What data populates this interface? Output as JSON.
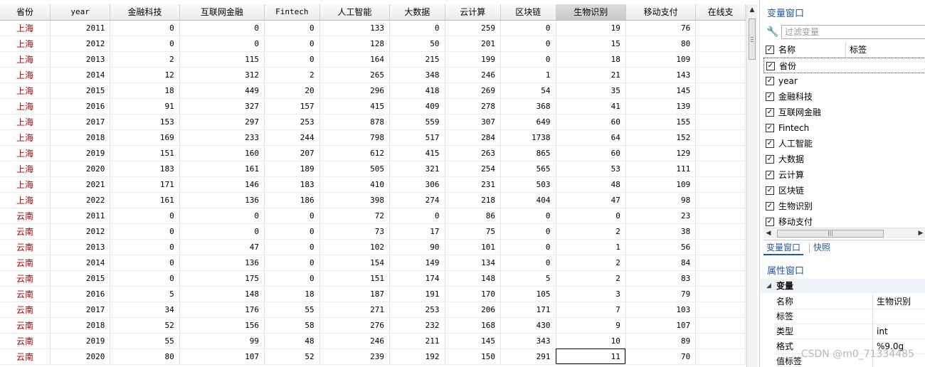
{
  "grid": {
    "columns": [
      {
        "label": "省份",
        "width": 71
      },
      {
        "label": "year",
        "width": 85,
        "mono": true
      },
      {
        "label": "金融科技",
        "width": 98
      },
      {
        "label": "互联网金融",
        "width": 120
      },
      {
        "label": "Fintech",
        "width": 78,
        "mono": true
      },
      {
        "label": "人工智能",
        "width": 99
      },
      {
        "label": "大数据",
        "width": 78
      },
      {
        "label": "云计算",
        "width": 79
      },
      {
        "label": "区块链",
        "width": 78
      },
      {
        "label": "生物识别",
        "width": 99,
        "selected": true
      },
      {
        "label": "移动支付",
        "width": 99
      },
      {
        "label": "在线支",
        "width": 70
      }
    ],
    "rows": [
      [
        "上海",
        "2011",
        "0",
        "0",
        "0",
        "133",
        "0",
        "259",
        "0",
        "19",
        "76",
        ""
      ],
      [
        "上海",
        "2012",
        "0",
        "0",
        "0",
        "128",
        "50",
        "201",
        "0",
        "15",
        "80",
        ""
      ],
      [
        "上海",
        "2013",
        "2",
        "115",
        "0",
        "164",
        "215",
        "199",
        "0",
        "18",
        "109",
        ""
      ],
      [
        "上海",
        "2014",
        "12",
        "312",
        "2",
        "265",
        "348",
        "246",
        "1",
        "21",
        "143",
        ""
      ],
      [
        "上海",
        "2015",
        "18",
        "449",
        "20",
        "296",
        "418",
        "269",
        "54",
        "35",
        "145",
        ""
      ],
      [
        "上海",
        "2016",
        "91",
        "327",
        "157",
        "415",
        "409",
        "278",
        "368",
        "41",
        "139",
        ""
      ],
      [
        "上海",
        "2017",
        "153",
        "297",
        "253",
        "878",
        "559",
        "307",
        "649",
        "60",
        "155",
        ""
      ],
      [
        "上海",
        "2018",
        "169",
        "233",
        "244",
        "798",
        "517",
        "284",
        "1738",
        "64",
        "152",
        ""
      ],
      [
        "上海",
        "2019",
        "151",
        "160",
        "207",
        "612",
        "415",
        "263",
        "865",
        "60",
        "129",
        ""
      ],
      [
        "上海",
        "2020",
        "183",
        "161",
        "189",
        "505",
        "321",
        "254",
        "565",
        "53",
        "111",
        ""
      ],
      [
        "上海",
        "2021",
        "171",
        "146",
        "183",
        "410",
        "306",
        "231",
        "503",
        "48",
        "109",
        ""
      ],
      [
        "上海",
        "2022",
        "161",
        "136",
        "186",
        "398",
        "274",
        "218",
        "404",
        "47",
        "98",
        ""
      ],
      [
        "云南",
        "2011",
        "0",
        "0",
        "0",
        "72",
        "0",
        "86",
        "0",
        "0",
        "23",
        ""
      ],
      [
        "云南",
        "2012",
        "0",
        "0",
        "0",
        "73",
        "17",
        "75",
        "0",
        "2",
        "38",
        ""
      ],
      [
        "云南",
        "2013",
        "0",
        "47",
        "0",
        "102",
        "90",
        "101",
        "0",
        "1",
        "56",
        ""
      ],
      [
        "云南",
        "2014",
        "0",
        "136",
        "0",
        "154",
        "149",
        "134",
        "0",
        "2",
        "84",
        ""
      ],
      [
        "云南",
        "2015",
        "0",
        "175",
        "0",
        "151",
        "174",
        "148",
        "5",
        "2",
        "83",
        ""
      ],
      [
        "云南",
        "2016",
        "5",
        "148",
        "18",
        "187",
        "191",
        "170",
        "105",
        "3",
        "79",
        ""
      ],
      [
        "云南",
        "2017",
        "34",
        "176",
        "55",
        "271",
        "253",
        "206",
        "171",
        "7",
        "103",
        ""
      ],
      [
        "云南",
        "2018",
        "52",
        "156",
        "58",
        "276",
        "232",
        "168",
        "430",
        "9",
        "107",
        ""
      ],
      [
        "云南",
        "2019",
        "55",
        "99",
        "48",
        "246",
        "211",
        "145",
        "343",
        "10",
        "89",
        ""
      ],
      [
        "云南",
        "2020",
        "80",
        "107",
        "52",
        "239",
        "192",
        "150",
        "291",
        "11",
        "70",
        ""
      ]
    ],
    "focused_row": 21,
    "focused_col": 9
  },
  "variables_window": {
    "title": "变量窗口",
    "filter_placeholder": "过滤变量",
    "col_name": "名称",
    "col_label": "标签",
    "items": [
      "省份",
      "year",
      "金融科技",
      "互联网金融",
      "Fintech",
      "人工智能",
      "大数据",
      "云计算",
      "区块链",
      "生物识别",
      "移动支付"
    ],
    "tabs": [
      "变量窗口",
      "快照"
    ]
  },
  "properties_window": {
    "title": "属性窗口",
    "section": "变量",
    "rows": [
      {
        "k": "名称",
        "v": "生物识别"
      },
      {
        "k": "标签",
        "v": ""
      },
      {
        "k": "类型",
        "v": "int"
      },
      {
        "k": "格式",
        "v": "%9.0g"
      },
      {
        "k": "值标签",
        "v": ""
      }
    ]
  },
  "watermark": "CSDN @m0_71334485",
  "icons": {
    "wrench": "wrench-icon",
    "check": "checkbox-checked-icon"
  }
}
